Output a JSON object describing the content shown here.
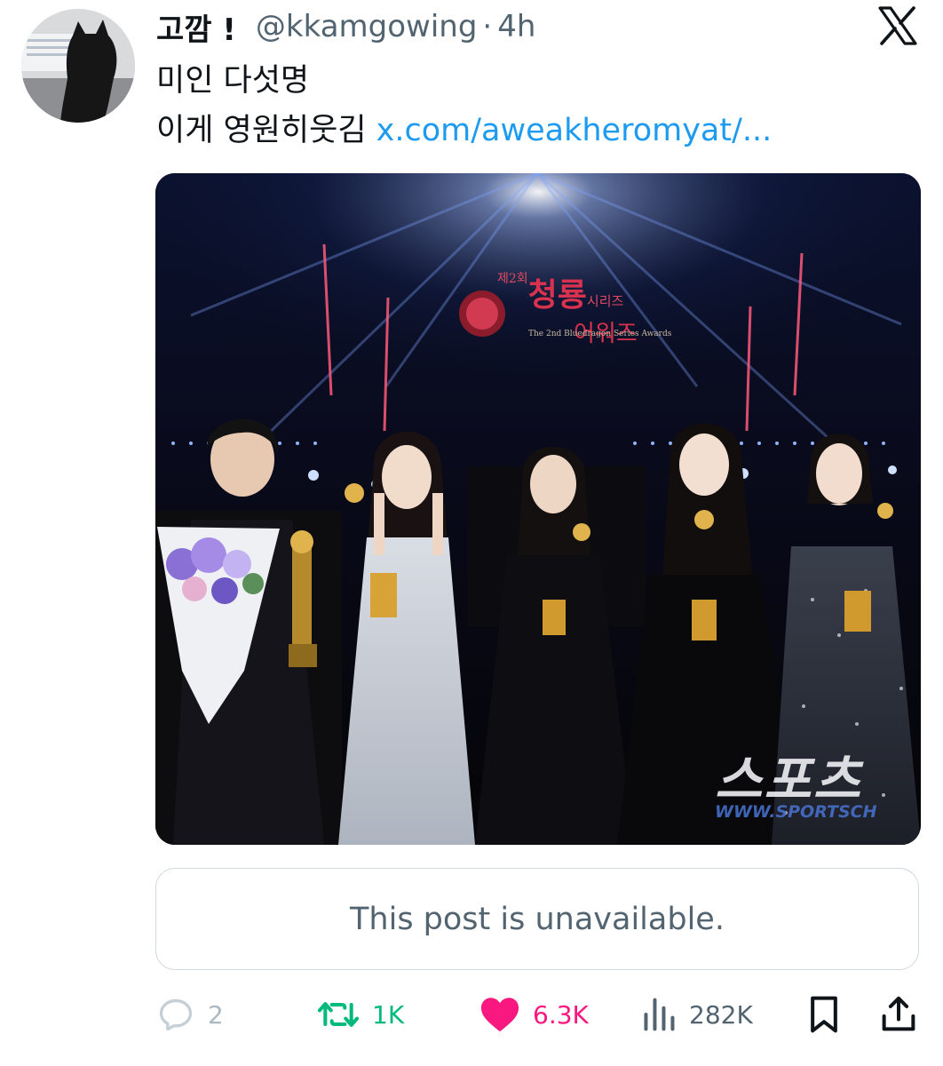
{
  "post": {
    "display_name": "고깜 !",
    "handle": "@kkamgowing",
    "separator": "·",
    "time": "4h",
    "text_line1": "미인 다섯명",
    "text_line2": "이게 영원히웃김",
    "link_text": "x.com/aweakheromyat/..."
  },
  "media": {
    "logo_small": "제2회",
    "logo_big": "청룡",
    "logo_mid": "시리즈",
    "logo_line2": "어워즈",
    "logo_english": "The 2nd Bluedragon Series Awards",
    "watermark": "스포츠",
    "watermark_url": "WWW.SPORTSCH"
  },
  "quote": {
    "message": "This post is unavailable."
  },
  "actions": {
    "replies": "2",
    "reposts": "1K",
    "likes": "6.3K",
    "views": "282K"
  },
  "colors": {
    "link": "#1d9bf0",
    "secondary_text": "#536471",
    "repost": "#00ba7c",
    "like": "#f91880",
    "border": "#cfd9de"
  },
  "icons": {
    "reply": "reply-icon",
    "repost": "repost-icon",
    "like": "heart-icon",
    "views": "views-icon",
    "bookmark": "bookmark-icon",
    "share": "share-icon",
    "brand": "x-logo-icon"
  }
}
